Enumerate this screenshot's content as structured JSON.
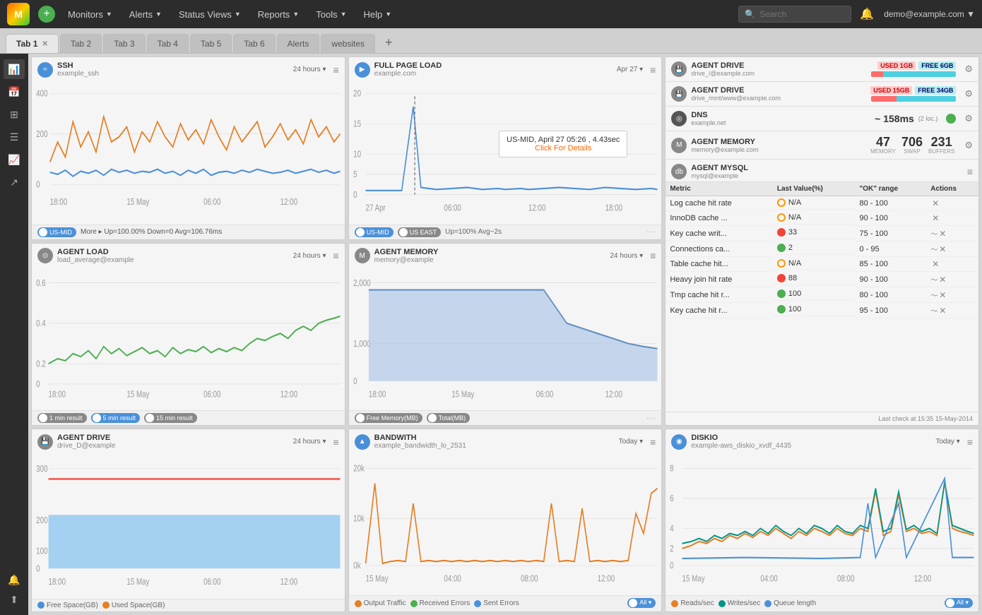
{
  "nav": {
    "add_label": "+",
    "monitors_label": "Monitors",
    "alerts_label": "Alerts",
    "status_views_label": "Status Views",
    "reports_label": "Reports",
    "tools_label": "Tools",
    "help_label": "Help",
    "search_placeholder": "Search",
    "user_label": "demo@example.com",
    "nav_icon1": "🔔",
    "nav_icon2": "👤"
  },
  "tabs": [
    {
      "label": "Tab 1",
      "active": true
    },
    {
      "label": "Tab 2",
      "active": false
    },
    {
      "label": "Tab 3",
      "active": false
    },
    {
      "label": "Tab 4",
      "active": false
    },
    {
      "label": "Tab 5",
      "active": false
    },
    {
      "label": "Tab 6",
      "active": false
    },
    {
      "label": "Alerts",
      "active": false
    },
    {
      "label": "websites",
      "active": false
    }
  ],
  "widgets": {
    "ssh": {
      "title": "SSH",
      "subtitle": "example_ssh",
      "time": "24 hours ▾",
      "footer_left": "US-MID",
      "footer_stats": "More ▸  Up=100.00%  Down=0  Avg=106.76ms"
    },
    "full_page_load": {
      "title": "FULL PAGE LOAD",
      "subtitle": "example.com",
      "time": "Apr 27 ▾",
      "tooltip_text": "US-MID, April 27 05:26 , 4.43sec",
      "tooltip_link": "Click For Details",
      "footer_left": "US-MID",
      "footer_right": "US EAST",
      "footer_stats": "Up=100%  Avg~2s"
    },
    "agent_load": {
      "title": "AGENT LOAD",
      "subtitle": "load_average@example",
      "time": "24 hours ▾",
      "legend_1min": "1 min result",
      "legend_5min": "5 min result",
      "legend_15min": "15 min result"
    },
    "agent_memory_chart": {
      "title": "AGENT MEMORY",
      "subtitle": "memory@example",
      "time": "24 hours ▾",
      "legend_free": "Free Memory(MB)",
      "legend_total": "Total(MB)"
    },
    "agent_drive_bottom": {
      "title": "AGENT DRIVE",
      "subtitle": "drive_D@example",
      "time": "24 hours ▾",
      "legend_free": "Free Space(GB)",
      "legend_used": "Used Space(GB)"
    },
    "bandwith": {
      "title": "BANDWITH",
      "subtitle": "example_bandwidth_lo_2531",
      "time": "Today ▾",
      "legend_out": "Output Traffic",
      "legend_recv": "Received Errors",
      "legend_sent": "Sent Errors",
      "legend_all": "All ▾"
    },
    "diskio": {
      "title": "DISKIO",
      "subtitle": "example-aws_diskio_xvdf_4435",
      "time": "Today ▾",
      "legend_reads": "Reads/sec",
      "legend_writes": "Writes/sec",
      "legend_queue": "Queue length",
      "legend_all": "All ▾"
    }
  },
  "right_panel": {
    "drive1": {
      "title": "AGENT DRIVE",
      "subtitle": "drive_/@example.com",
      "used_label": "USED",
      "free_label": "FREE",
      "used_val": "1GB",
      "free_val": "6GB"
    },
    "drive2": {
      "title": "AGENT DRIVE",
      "subtitle": "drive_/mnt/www@example.com",
      "used_label": "USED",
      "free_label": "FREE",
      "used_val": "15GB",
      "free_val": "34GB"
    },
    "dns": {
      "title": "DNS",
      "subtitle": "example.net",
      "value": "~ 158ms",
      "note": "(2 loc.)"
    },
    "memory": {
      "title": "AGENT MEMORY",
      "subtitle": "memory@example.com",
      "memory_val": "47",
      "swap_val": "706",
      "buffers_val": "231",
      "memory_label": "MEMORY",
      "swap_label": "SWAP",
      "buffers_label": "BUFFERS"
    },
    "mysql": {
      "title": "AGENT MYSQL",
      "subtitle": "mysql@example",
      "table_headers": [
        "Metric",
        "Last Value(%)",
        "\"OK\" range",
        "Actions"
      ],
      "rows": [
        {
          "metric": "Log cache hit rate",
          "status": "info",
          "value": "N/A",
          "ok_range": "80 - 100",
          "has_action": false
        },
        {
          "metric": "InnoDB cache ...",
          "status": "info",
          "value": "N/A",
          "ok_range": "90 - 100",
          "has_action": false
        },
        {
          "metric": "Key cache writ...",
          "status": "error",
          "value": "33",
          "ok_range": "75 - 100",
          "has_action": true
        },
        {
          "metric": "Connections ca...",
          "status": "ok",
          "value": "2",
          "ok_range": "0 - 95",
          "has_action": true
        },
        {
          "metric": "Table cache hit...",
          "status": "info",
          "value": "N/A",
          "ok_range": "85 - 100",
          "has_action": false
        },
        {
          "metric": "Heavy join hit rate",
          "status": "error",
          "value": "88",
          "ok_range": "90 - 100",
          "has_action": true
        },
        {
          "metric": "Tmp cache hit r...",
          "status": "ok",
          "value": "100",
          "ok_range": "80 - 100",
          "has_action": true
        },
        {
          "metric": "Key cache hit r...",
          "status": "ok",
          "value": "100",
          "ok_range": "95 - 100",
          "has_action": true
        }
      ],
      "footer": "Last check at 15:35 15-May-2014"
    }
  },
  "colors": {
    "accent_blue": "#4a90d9",
    "accent_green": "#4caf50",
    "accent_orange": "#ff9800",
    "accent_red": "#f44336",
    "accent_teal": "#00bcd4"
  }
}
